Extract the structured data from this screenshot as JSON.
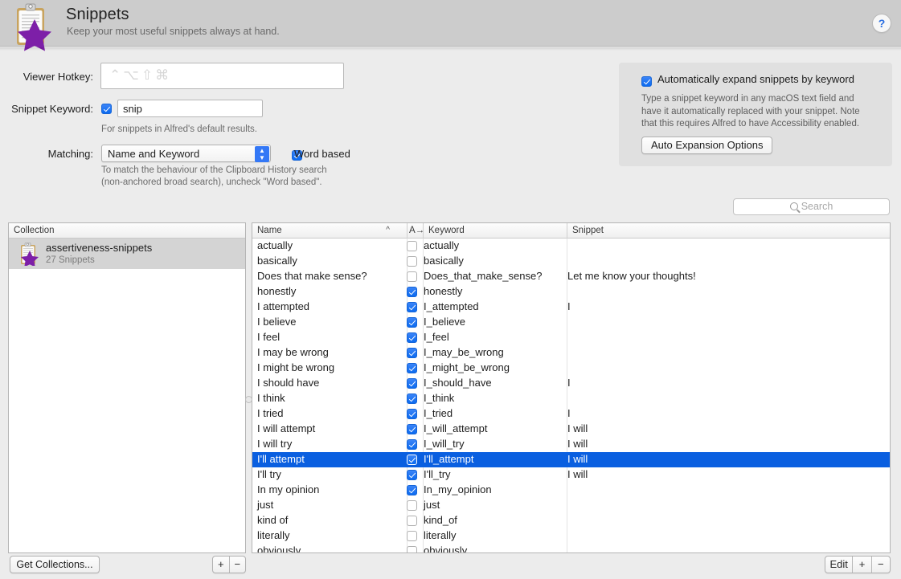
{
  "header": {
    "title": "Snippets",
    "subtitle": "Keep your most useful snippets always at hand.",
    "help_label": "?",
    "icon": "snippets-clipboard-star-icon"
  },
  "form": {
    "viewer_hotkey_label": "Viewer Hotkey:",
    "viewer_hotkey_value": "⌃⌥⇧⌘",
    "snippet_keyword_label": "Snippet Keyword:",
    "snippet_keyword_enabled": true,
    "snippet_keyword_value": "snip",
    "snippet_keyword_hint": "For snippets in Alfred's default results.",
    "matching_label": "Matching:",
    "matching_value": "Name and Keyword",
    "matching_options": [
      "Name and Keyword"
    ],
    "word_based_label": "Word based",
    "word_based_enabled": true,
    "matching_hint_line1": "To match the behaviour of the Clipboard History search",
    "matching_hint_line2": "(non-anchored broad search), uncheck \"Word based\"."
  },
  "expansion": {
    "checkbox_label": "Automatically expand snippets by keyword",
    "checkbox_enabled": true,
    "description_line1": "Type a snippet keyword in any macOS text field and",
    "description_line2": "have it automatically replaced with your snippet. Note",
    "description_line3": "that this requires Alfred to have Accessibility enabled.",
    "button_label": "Auto Expansion Options"
  },
  "search": {
    "placeholder": "Search",
    "value": ""
  },
  "collection_panel": {
    "header": "Collection",
    "items": [
      {
        "name": "assertiveness-snippets",
        "count": "27 Snippets",
        "selected": true
      }
    ]
  },
  "table": {
    "columns": {
      "name": "Name",
      "autoexpand": "A→",
      "keyword": "Keyword",
      "snippet": "Snippet"
    },
    "sort_indicator": "^",
    "rows": [
      {
        "name": "actually",
        "auto": false,
        "keyword": "actually",
        "snippet": "",
        "selected": false
      },
      {
        "name": "basically",
        "auto": false,
        "keyword": "basically",
        "snippet": "",
        "selected": false
      },
      {
        "name": "Does that make sense?",
        "auto": false,
        "keyword": "Does_that_make_sense?",
        "snippet": "Let me know your thoughts!",
        "selected": false
      },
      {
        "name": "honestly",
        "auto": true,
        "keyword": "honestly",
        "snippet": "",
        "selected": false
      },
      {
        "name": "I attempted",
        "auto": true,
        "keyword": "I_attempted",
        "snippet": "I",
        "selected": false
      },
      {
        "name": "I believe",
        "auto": true,
        "keyword": "I_believe",
        "snippet": "",
        "selected": false
      },
      {
        "name": "I feel",
        "auto": true,
        "keyword": "I_feel",
        "snippet": "",
        "selected": false
      },
      {
        "name": "I may be wrong",
        "auto": true,
        "keyword": "I_may_be_wrong",
        "snippet": "",
        "selected": false
      },
      {
        "name": "I might be wrong",
        "auto": true,
        "keyword": "I_might_be_wrong",
        "snippet": "",
        "selected": false
      },
      {
        "name": "I should have",
        "auto": true,
        "keyword": "I_should_have",
        "snippet": "I",
        "selected": false
      },
      {
        "name": "I think",
        "auto": true,
        "keyword": "I_think",
        "snippet": "",
        "selected": false
      },
      {
        "name": "I tried",
        "auto": true,
        "keyword": "I_tried",
        "snippet": "I",
        "selected": false
      },
      {
        "name": "I will attempt",
        "auto": true,
        "keyword": "I_will_attempt",
        "snippet": "I will",
        "selected": false
      },
      {
        "name": "I will try",
        "auto": true,
        "keyword": "I_will_try",
        "snippet": "I will",
        "selected": false
      },
      {
        "name": "I'll attempt",
        "auto": true,
        "keyword": "I'll_attempt",
        "snippet": "I will",
        "selected": true
      },
      {
        "name": "I'll try",
        "auto": true,
        "keyword": "I'll_try",
        "snippet": "I will",
        "selected": false
      },
      {
        "name": "In my opinion",
        "auto": true,
        "keyword": "In_my_opinion",
        "snippet": "",
        "selected": false
      },
      {
        "name": "just",
        "auto": false,
        "keyword": "just",
        "snippet": "",
        "selected": false
      },
      {
        "name": "kind of",
        "auto": false,
        "keyword": "kind_of",
        "snippet": "",
        "selected": false
      },
      {
        "name": "literally",
        "auto": false,
        "keyword": "literally",
        "snippet": "",
        "selected": false
      },
      {
        "name": "obviously",
        "auto": false,
        "keyword": "obviously",
        "snippet": "",
        "selected": false
      }
    ]
  },
  "bottom_bar": {
    "get_collections_label": "Get Collections...",
    "collection_add_label": "+",
    "collection_remove_label": "−",
    "edit_label": "Edit",
    "snippet_add_label": "+",
    "snippet_remove_label": "−"
  },
  "colors": {
    "accent": "#0a5fe0",
    "checkbox_blue": "#1565d8",
    "header_bg": "#cccccc",
    "window_bg": "#ececec",
    "selection_blue": "#0a5fe0"
  }
}
